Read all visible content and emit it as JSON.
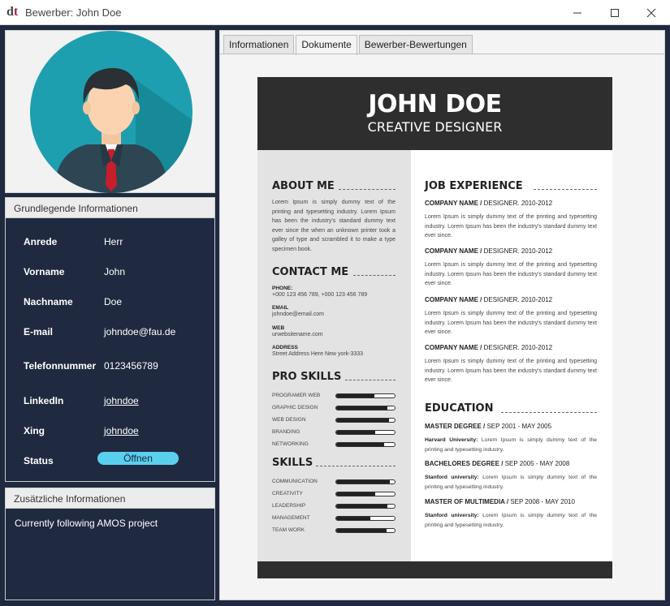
{
  "window": {
    "title": "Bewerber: John Doe",
    "icon": "app-logo-icon",
    "controls": [
      "minimize-icon",
      "maximize-icon",
      "close-icon"
    ]
  },
  "left": {
    "basic_info_title": "Grundlegende Informationen",
    "fields": [
      {
        "label": "Anrede",
        "value": "Herr"
      },
      {
        "label": "Vorname",
        "value": "John"
      },
      {
        "label": "Nachname",
        "value": "Doe"
      },
      {
        "label": "E-mail",
        "value": "johndoe@fau.de"
      },
      {
        "label": "Telefonnummer",
        "value": "0123456789"
      },
      {
        "label": "LinkedIn",
        "value": "johndoe"
      },
      {
        "label": "Xing",
        "value": "johndoe"
      },
      {
        "label": "Status",
        "value": "Öffnen"
      }
    ],
    "extra_info_title": "Zusätzliche Informationen",
    "extra_info_text": "Currently following AMOS project"
  },
  "tabs": [
    "Informationen",
    "Dokumente",
    "Bewerber-Bewertungen"
  ],
  "active_tab": "Dokumente",
  "resume": {
    "name": "JOHN DOE",
    "role": "CREATIVE DESIGNER",
    "about_title": "ABOUT ME",
    "about_text": "Lorem Ipsum is simply dummy text of the printing and typesetting industry. Lorem Ipsum has been the industry's standard dummy text ever since the when an unknown printer took a galley of type and scrambled it to make a type specimen book.",
    "contact_title": "CONTACT ME",
    "contact": [
      {
        "label": "PHONE:",
        "value": "+000 123 456 789, +000 123 456 789"
      },
      {
        "label": "EMAIL",
        "value": "johndoe@email.com"
      },
      {
        "label": "WEB",
        "value": "urwebsitename.com"
      },
      {
        "label": "ADDRESS",
        "value": "Street Address Here New york-3333"
      }
    ],
    "pro_skills_title": "PRO SKILLS",
    "pro_skills": [
      {
        "name": "PROGRAMER WEB",
        "level": 0.65
      },
      {
        "name": "GRAPHIC DESIGN",
        "level": 0.88
      },
      {
        "name": "WEB DESIGN",
        "level": 0.9
      },
      {
        "name": "BRANDING",
        "level": 0.67
      },
      {
        "name": "NETWORKING",
        "level": 0.82
      }
    ],
    "skills_title": "SKILLS",
    "skills": [
      {
        "name": "COMMUNICATION",
        "level": 0.92
      },
      {
        "name": "CREATIVITY",
        "level": 0.67
      },
      {
        "name": "LEADERSHIP",
        "level": 0.88
      },
      {
        "name": "MANAGEMENT",
        "level": 0.59
      },
      {
        "name": "TEAM WORK",
        "level": 0.86
      }
    ],
    "job_title": "JOB EXPERIENCE",
    "jobs": [
      {
        "company": "COMPANY NAME /",
        "detail": " DESIGNER. 2010-2012",
        "text": "Lorem Ipsum is simply dummy text of the printing and typesetting industry. Lorem Ipsum has been the industry's standard dummy text ever since."
      },
      {
        "company": "COMPANY NAME /",
        "detail": " DESIGNER. 2010-2012",
        "text": "Lorem Ipsum is simply dummy text of the printing and typesetting industry. Lorem Ipsum has been the industry's standard dummy text ever since."
      },
      {
        "company": "COMPANY NAME /",
        "detail": " DESIGNER. 2010-2012",
        "text": "Lorem Ipsum is simply dummy text of the printing and typesetting industry. Lorem Ipsum has been the industry's standard dummy text ever since."
      },
      {
        "company": "COMPANY NAME /",
        "detail": " DESIGNER. 2010-2012",
        "text": "Lorem Ipsum is simply dummy text of the printing and typesetting industry. Lorem Ipsum has been the industry's standard dummy text ever since."
      }
    ],
    "education_title": "EDUCATION",
    "education": [
      {
        "degree": "MASTER DEGREE /",
        "dates": " SEP 2001 - MAY 2005",
        "school": "Harvard University:",
        "text": " Lorem Ipsum is simply dummy text of the printing and typesetting industry."
      },
      {
        "degree": "BACHELORES DEGREE /",
        "dates": " SEP 2005 - MAY 2008",
        "school": "Stanford university:",
        "text": " Lorem Ipsum is simply dummy text of the printing and typesetting industry."
      },
      {
        "degree": "MASTER OF MULTIMEDIA /",
        "dates": " SEP 2008 - MAY 2010",
        "school": "Stanford university:",
        "text": " Lorem Ipsum is simply dummy text of the printing and typesetting industry."
      }
    ]
  },
  "colors": {
    "panel_bg": "#1f2a40",
    "status_pill": "#5ad0ef",
    "resume_dark": "#2e2e2e",
    "resume_side": "#e3e3e3",
    "avatar_circle": "#1e9fb0"
  }
}
